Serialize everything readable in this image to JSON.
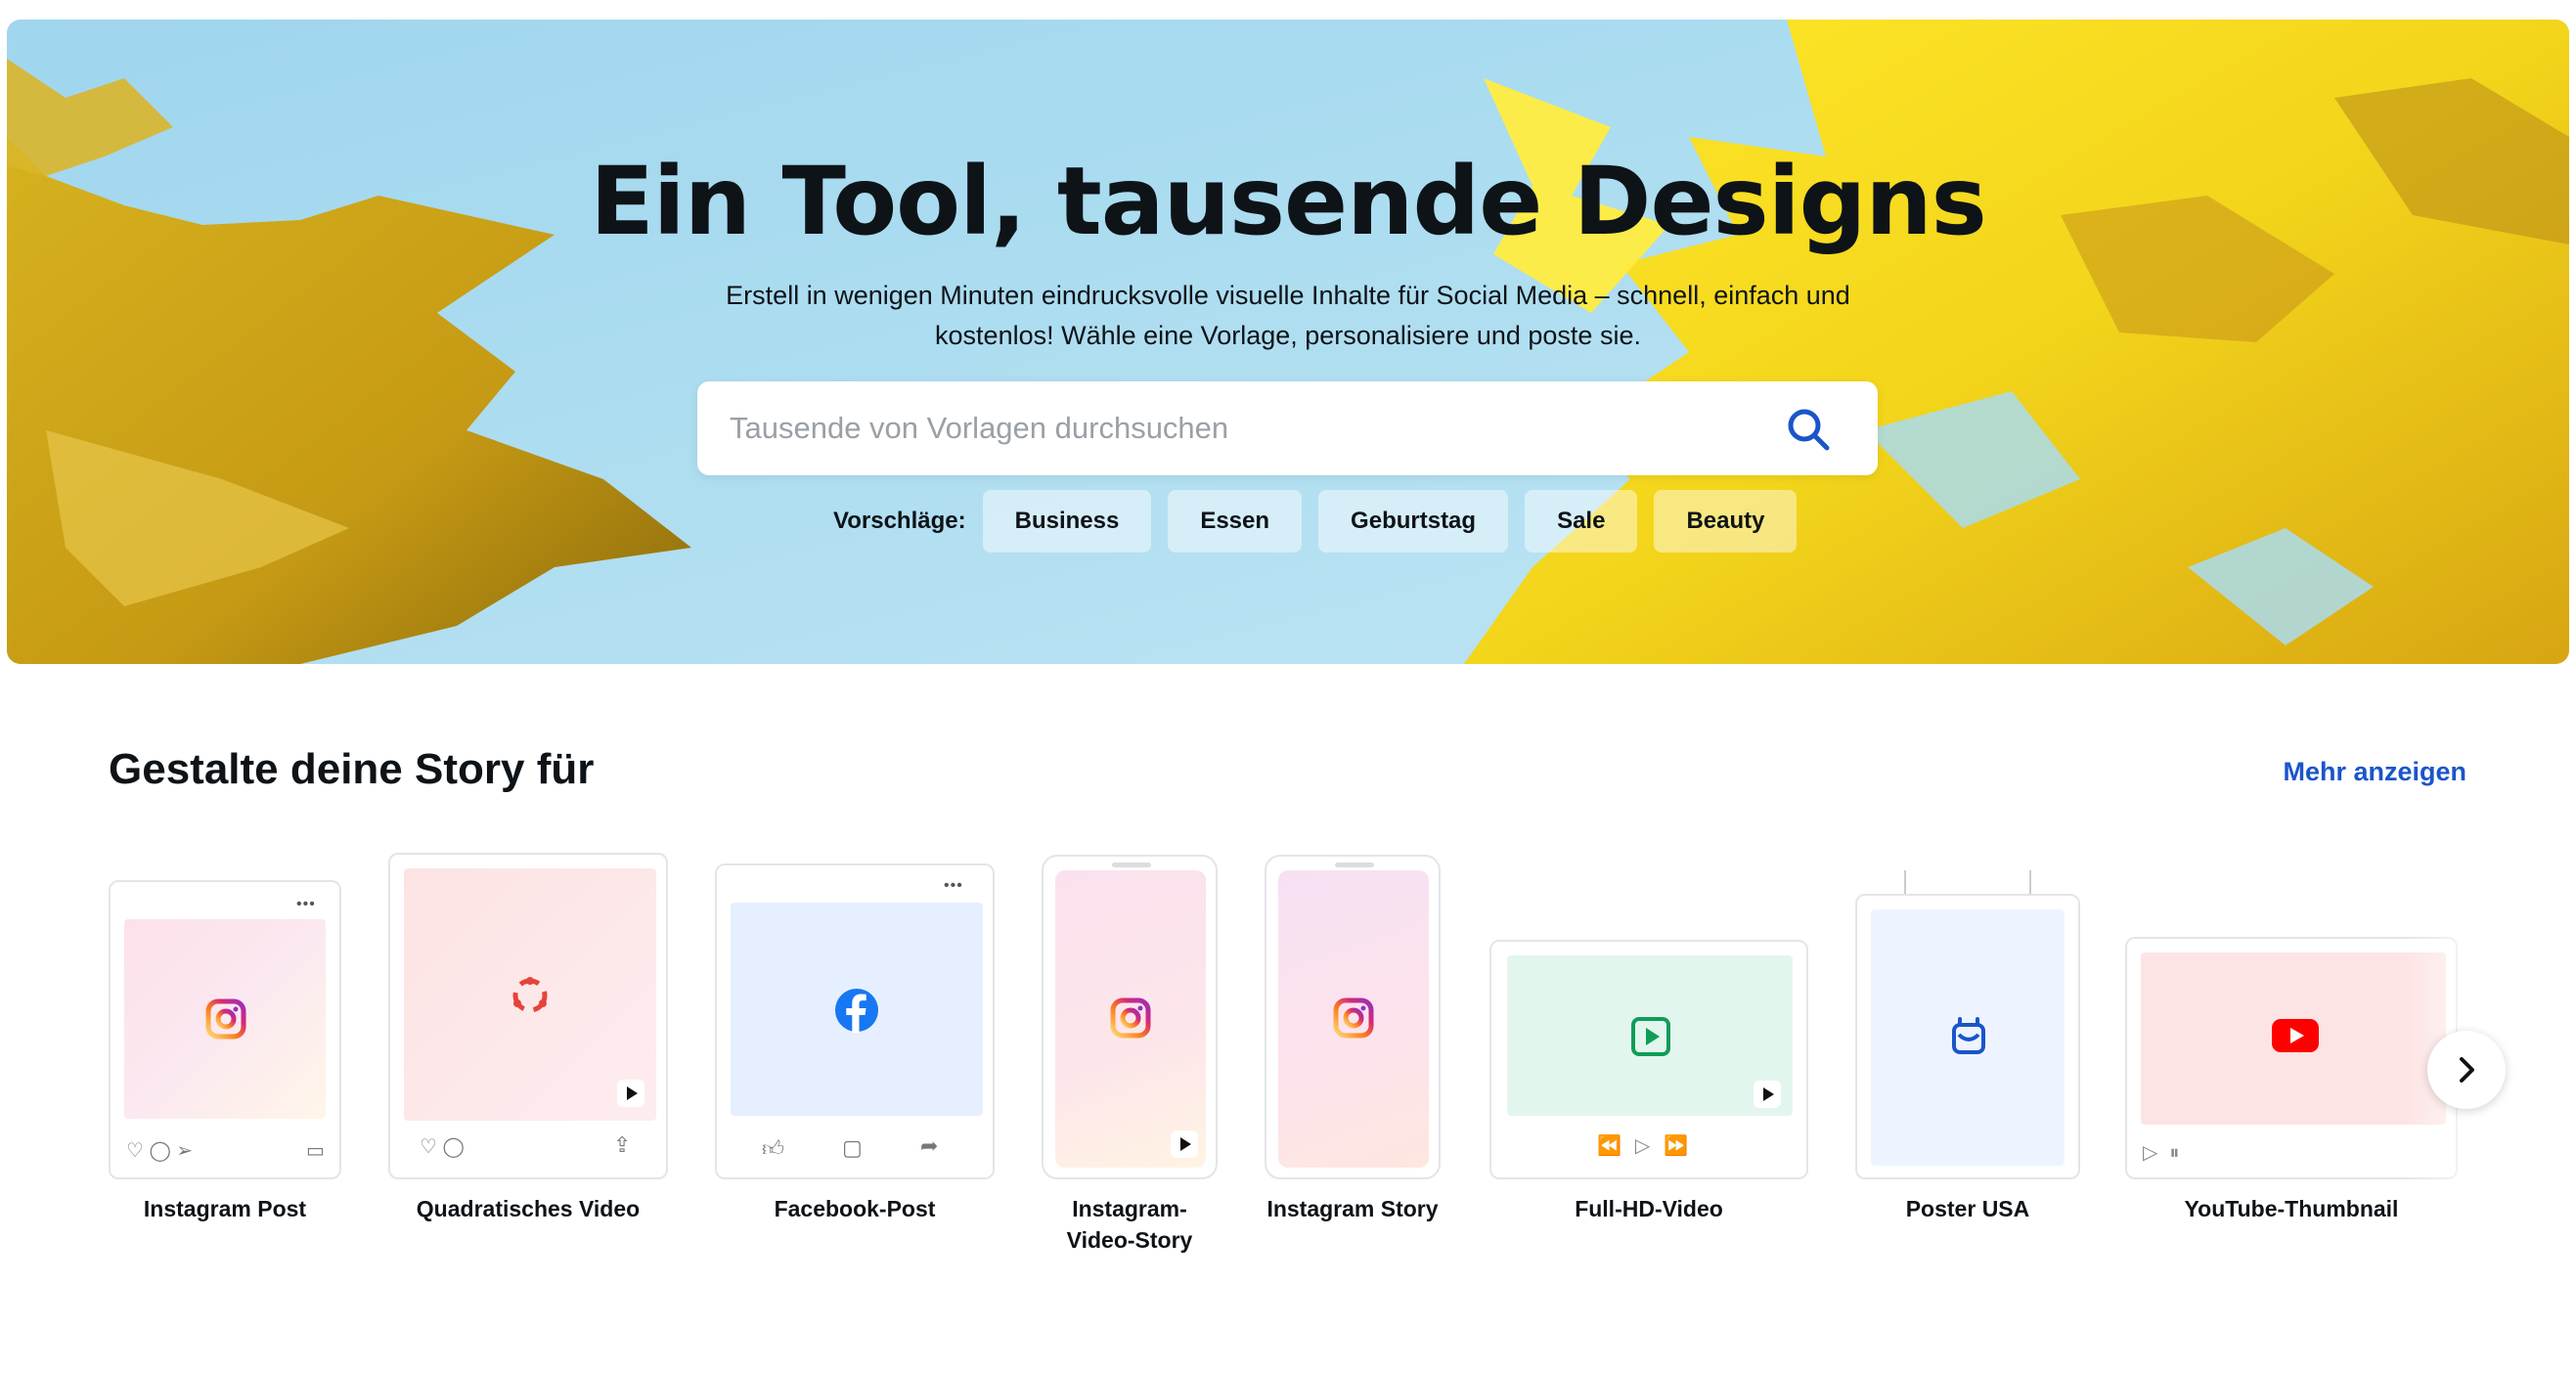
{
  "hero": {
    "title": "Ein Tool, tausende Designs",
    "subtitle": "Erstell in wenigen Minuten eindrucksvolle visuelle Inhalte für Social Media – schnell, einfach und kostenlos! Wähle eine Vorlage, personalisiere und poste sie.",
    "search_placeholder": "Tausende von Vorlagen durchsuchen",
    "suggestions_label": "Vorschläge:",
    "suggestions": [
      "Business",
      "Essen",
      "Geburtstag",
      "Sale",
      "Beauty"
    ]
  },
  "section": {
    "title": "Gestalte deine Story für",
    "more_link": "Mehr anzeigen",
    "cards": [
      {
        "label": "Instagram Post",
        "icon": "instagram-icon"
      },
      {
        "label": "Quadratisches Video",
        "icon": "collab-icon"
      },
      {
        "label": "Facebook-Post",
        "icon": "facebook-icon"
      },
      {
        "label": "Instagram-Video-Story",
        "icon": "instagram-icon"
      },
      {
        "label": "Instagram Story",
        "icon": "instagram-icon"
      },
      {
        "label": "Full-HD-Video",
        "icon": "video-play-icon"
      },
      {
        "label": "Poster USA",
        "icon": "poster-icon"
      },
      {
        "label": "YouTube-Thumbnail",
        "icon": "youtube-icon"
      }
    ]
  },
  "colors": {
    "accent": "#1a55c9",
    "sky": "#a9dcef",
    "leaf_yellow": "#f6dd1c",
    "youtube_red": "#ff0000",
    "facebook_blue": "#1877f2"
  }
}
